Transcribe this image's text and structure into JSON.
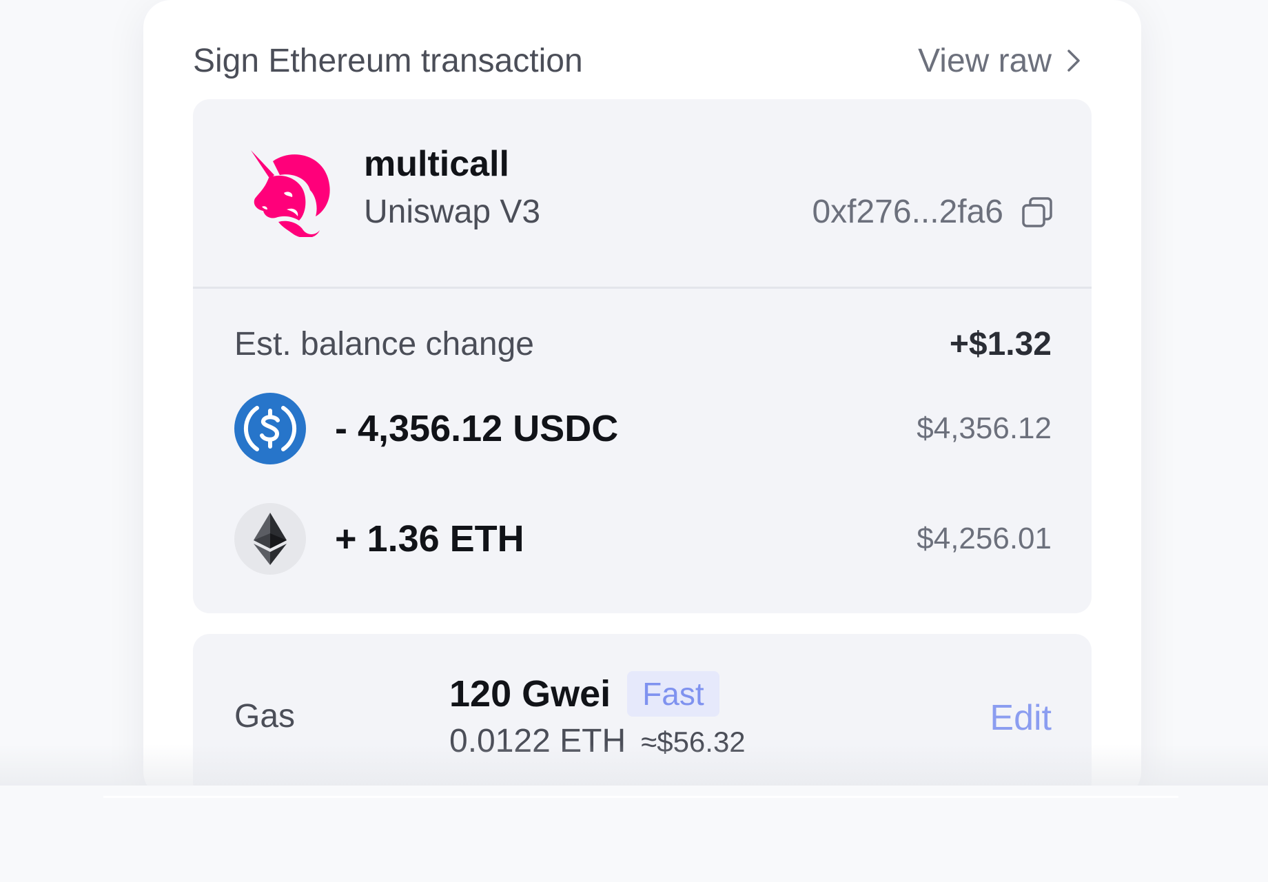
{
  "header": {
    "title": "Sign Ethereum transaction",
    "view_raw_label": "View raw"
  },
  "contract": {
    "name": "multicall",
    "protocol": "Uniswap V3",
    "address": "0xf276...2fa6",
    "logo_icon": "uniswap-unicorn-icon",
    "copy_icon": "copy-icon"
  },
  "balance": {
    "label": "Est. balance change",
    "total": "+$1.32",
    "tokens": [
      {
        "icon": "usdc-icon",
        "amount": "- 4,356.12 USDC",
        "fiat": "$4,356.12"
      },
      {
        "icon": "eth-icon",
        "amount": "+ 1.36 ETH",
        "fiat": "$4,256.01"
      }
    ]
  },
  "gas": {
    "label": "Gas",
    "gwei": "120 Gwei",
    "speed": "Fast",
    "eth": "0.0122 ETH",
    "usd": "≈$56.32",
    "edit_label": "Edit"
  },
  "colors": {
    "accent": "#8b9df0",
    "uniswap_pink": "#ff007a",
    "usdc_blue": "#2775ca",
    "panel_bg": "#f3f4f8"
  }
}
